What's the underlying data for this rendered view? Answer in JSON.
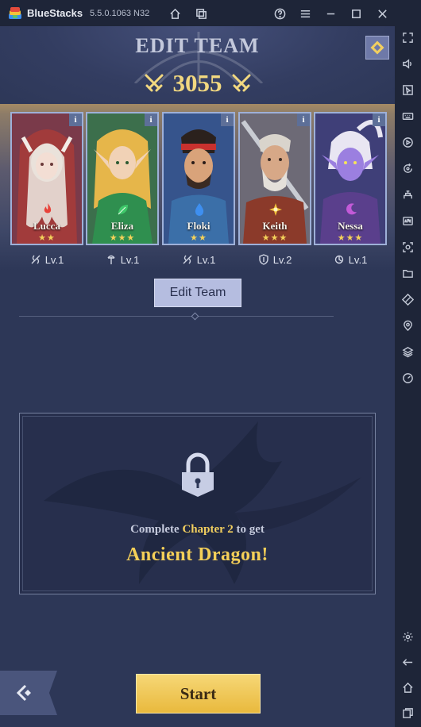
{
  "window": {
    "app_name": "BlueStacks",
    "version": "5.5.0.1063 N32",
    "icons": [
      "home-icon",
      "multi-instance-icon",
      "help-icon",
      "menu-icon",
      "minimize-icon",
      "maximize-icon",
      "close-icon"
    ]
  },
  "sidebar": {
    "tools": [
      "fullscreen-icon",
      "volume-icon",
      "cursor-icon",
      "keyboard-icon",
      "record-icon",
      "rotate-icon",
      "macro-icon",
      "apk-icon",
      "screenshot-icon",
      "folder-icon",
      "eco-icon",
      "location-icon",
      "layers-icon",
      "gauge-icon",
      "settings-icon",
      "back-icon",
      "home-icon",
      "recent-apps-icon"
    ]
  },
  "game": {
    "title": "EDIT TEAM",
    "team_power": "3055",
    "heroes": [
      {
        "name": "Lucca",
        "stars": "★★",
        "level": "Lv.1",
        "element": "fire",
        "element_color": "#e8423a",
        "bg": "#7a3a4a",
        "accent": "#e9e2dc"
      },
      {
        "name": "Eliza",
        "stars": "★★★",
        "level": "Lv.1",
        "element": "nature",
        "element_color": "#3fc86a",
        "bg": "#3c6f4c",
        "accent": "#f0c35a"
      },
      {
        "name": "Floki",
        "stars": "★★",
        "level": "Lv.1",
        "element": "water",
        "element_color": "#3e8ff0",
        "bg": "#36548c",
        "accent": "#3a2a22"
      },
      {
        "name": "Keith",
        "stars": "★★★",
        "level": "Lv.2",
        "element": "light",
        "element_color": "#f0c23a",
        "bg": "#6d6a76",
        "accent": "#d9d4cc"
      },
      {
        "name": "Nessa",
        "stars": "★★★",
        "level": "Lv.1",
        "element": "dark",
        "element_color": "#c35ad8",
        "bg": "#3f3f78",
        "accent": "#9b7fe0"
      }
    ],
    "edit_team_label": "Edit Team",
    "locked": {
      "prefix": "Complete",
      "chapter": "Chapter 2",
      "suffix": "to get",
      "reward": "Ancient Dragon!"
    },
    "start_label": "Start",
    "colors": {
      "gold": "#f2d880",
      "button_gold": "#e9b93d",
      "panel": "#2d3757"
    }
  }
}
